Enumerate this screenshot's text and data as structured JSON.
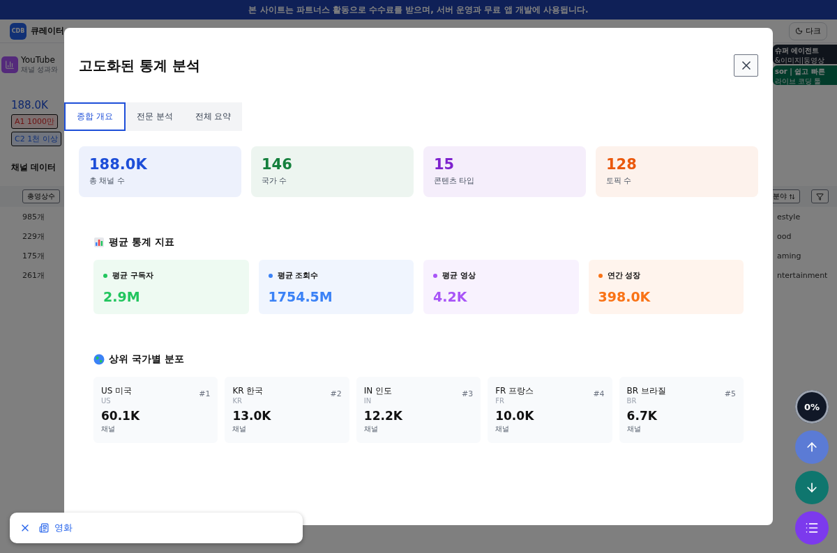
{
  "banner": {
    "text": "본 사이트는 파트너스 활동으로 수수료를 받으며, 서버 운영과 무료 앱 개발에 사용됩니다."
  },
  "header": {
    "logo": "CDB",
    "title": "큐레이터",
    "theme_button": "다크"
  },
  "page_card": {
    "title": "YouTube",
    "subtitle": "채널 성과와"
  },
  "ads": [
    {
      "title": "슈퍼 에이전트",
      "subtitle": "&이미지|동영상"
    },
    {
      "title": "sor | 쉽고 빠른",
      "subtitle": "라이브 코딩 툴"
    }
  ],
  "summary": {
    "count": "188.0K",
    "tags": [
      "A1 1000만",
      "C2 1천 이상"
    ]
  },
  "channel_data": {
    "title": "채널 데이터",
    "sort_button": "총영상수",
    "field_button": "분야",
    "counts": [
      "985개",
      "229개",
      "175개",
      "261개"
    ],
    "categories": [
      "estyle",
      "ood",
      "aming",
      "ntertainment"
    ]
  },
  "modal": {
    "title": "고도화된 통계 분석",
    "tabs": [
      {
        "label": "종합 개요",
        "selected": true
      },
      {
        "label": "전문 분석",
        "selected": false
      },
      {
        "label": "전체 요약",
        "selected": false
      }
    ],
    "stats": [
      {
        "value": "188.0K",
        "label": "총 채널 수",
        "color": "#1d4ed8"
      },
      {
        "value": "146",
        "label": "국가 수",
        "color": "#15803d"
      },
      {
        "value": "15",
        "label": "콘텐츠 타입",
        "color": "#7e22ce"
      },
      {
        "value": "128",
        "label": "토픽 수",
        "color": "#ea580c"
      }
    ],
    "averages_title": "평균 통계 지표",
    "averages": [
      {
        "label": "평균 구독자",
        "value": "2.9M",
        "color": "#22c55e"
      },
      {
        "label": "평균 조회수",
        "value": "1754.5M",
        "color": "#3b82f6"
      },
      {
        "label": "평균 영상",
        "value": "4.2K",
        "color": "#a855f7"
      },
      {
        "label": "연간 성장",
        "value": "398.0K",
        "color": "#f97316"
      }
    ],
    "countries_title": "상위 국가별 분포",
    "countries": [
      {
        "name": "US 미국",
        "code": "US",
        "rank": "#1",
        "value": "60.1K",
        "unit": "채널"
      },
      {
        "name": "KR 한국",
        "code": "KR",
        "rank": "#2",
        "value": "13.0K",
        "unit": "채널"
      },
      {
        "name": "IN 인도",
        "code": "IN",
        "rank": "#3",
        "value": "12.2K",
        "unit": "채널"
      },
      {
        "name": "FR 프랑스",
        "code": "FR",
        "rank": "#4",
        "value": "10.0K",
        "unit": "채널"
      },
      {
        "name": "BR 브라질",
        "code": "BR",
        "rank": "#5",
        "value": "6.7K",
        "unit": "채널"
      }
    ]
  },
  "scroll_progress": {
    "text": "0%",
    "level": 0
  },
  "filter_chip": {
    "label": "영화"
  }
}
